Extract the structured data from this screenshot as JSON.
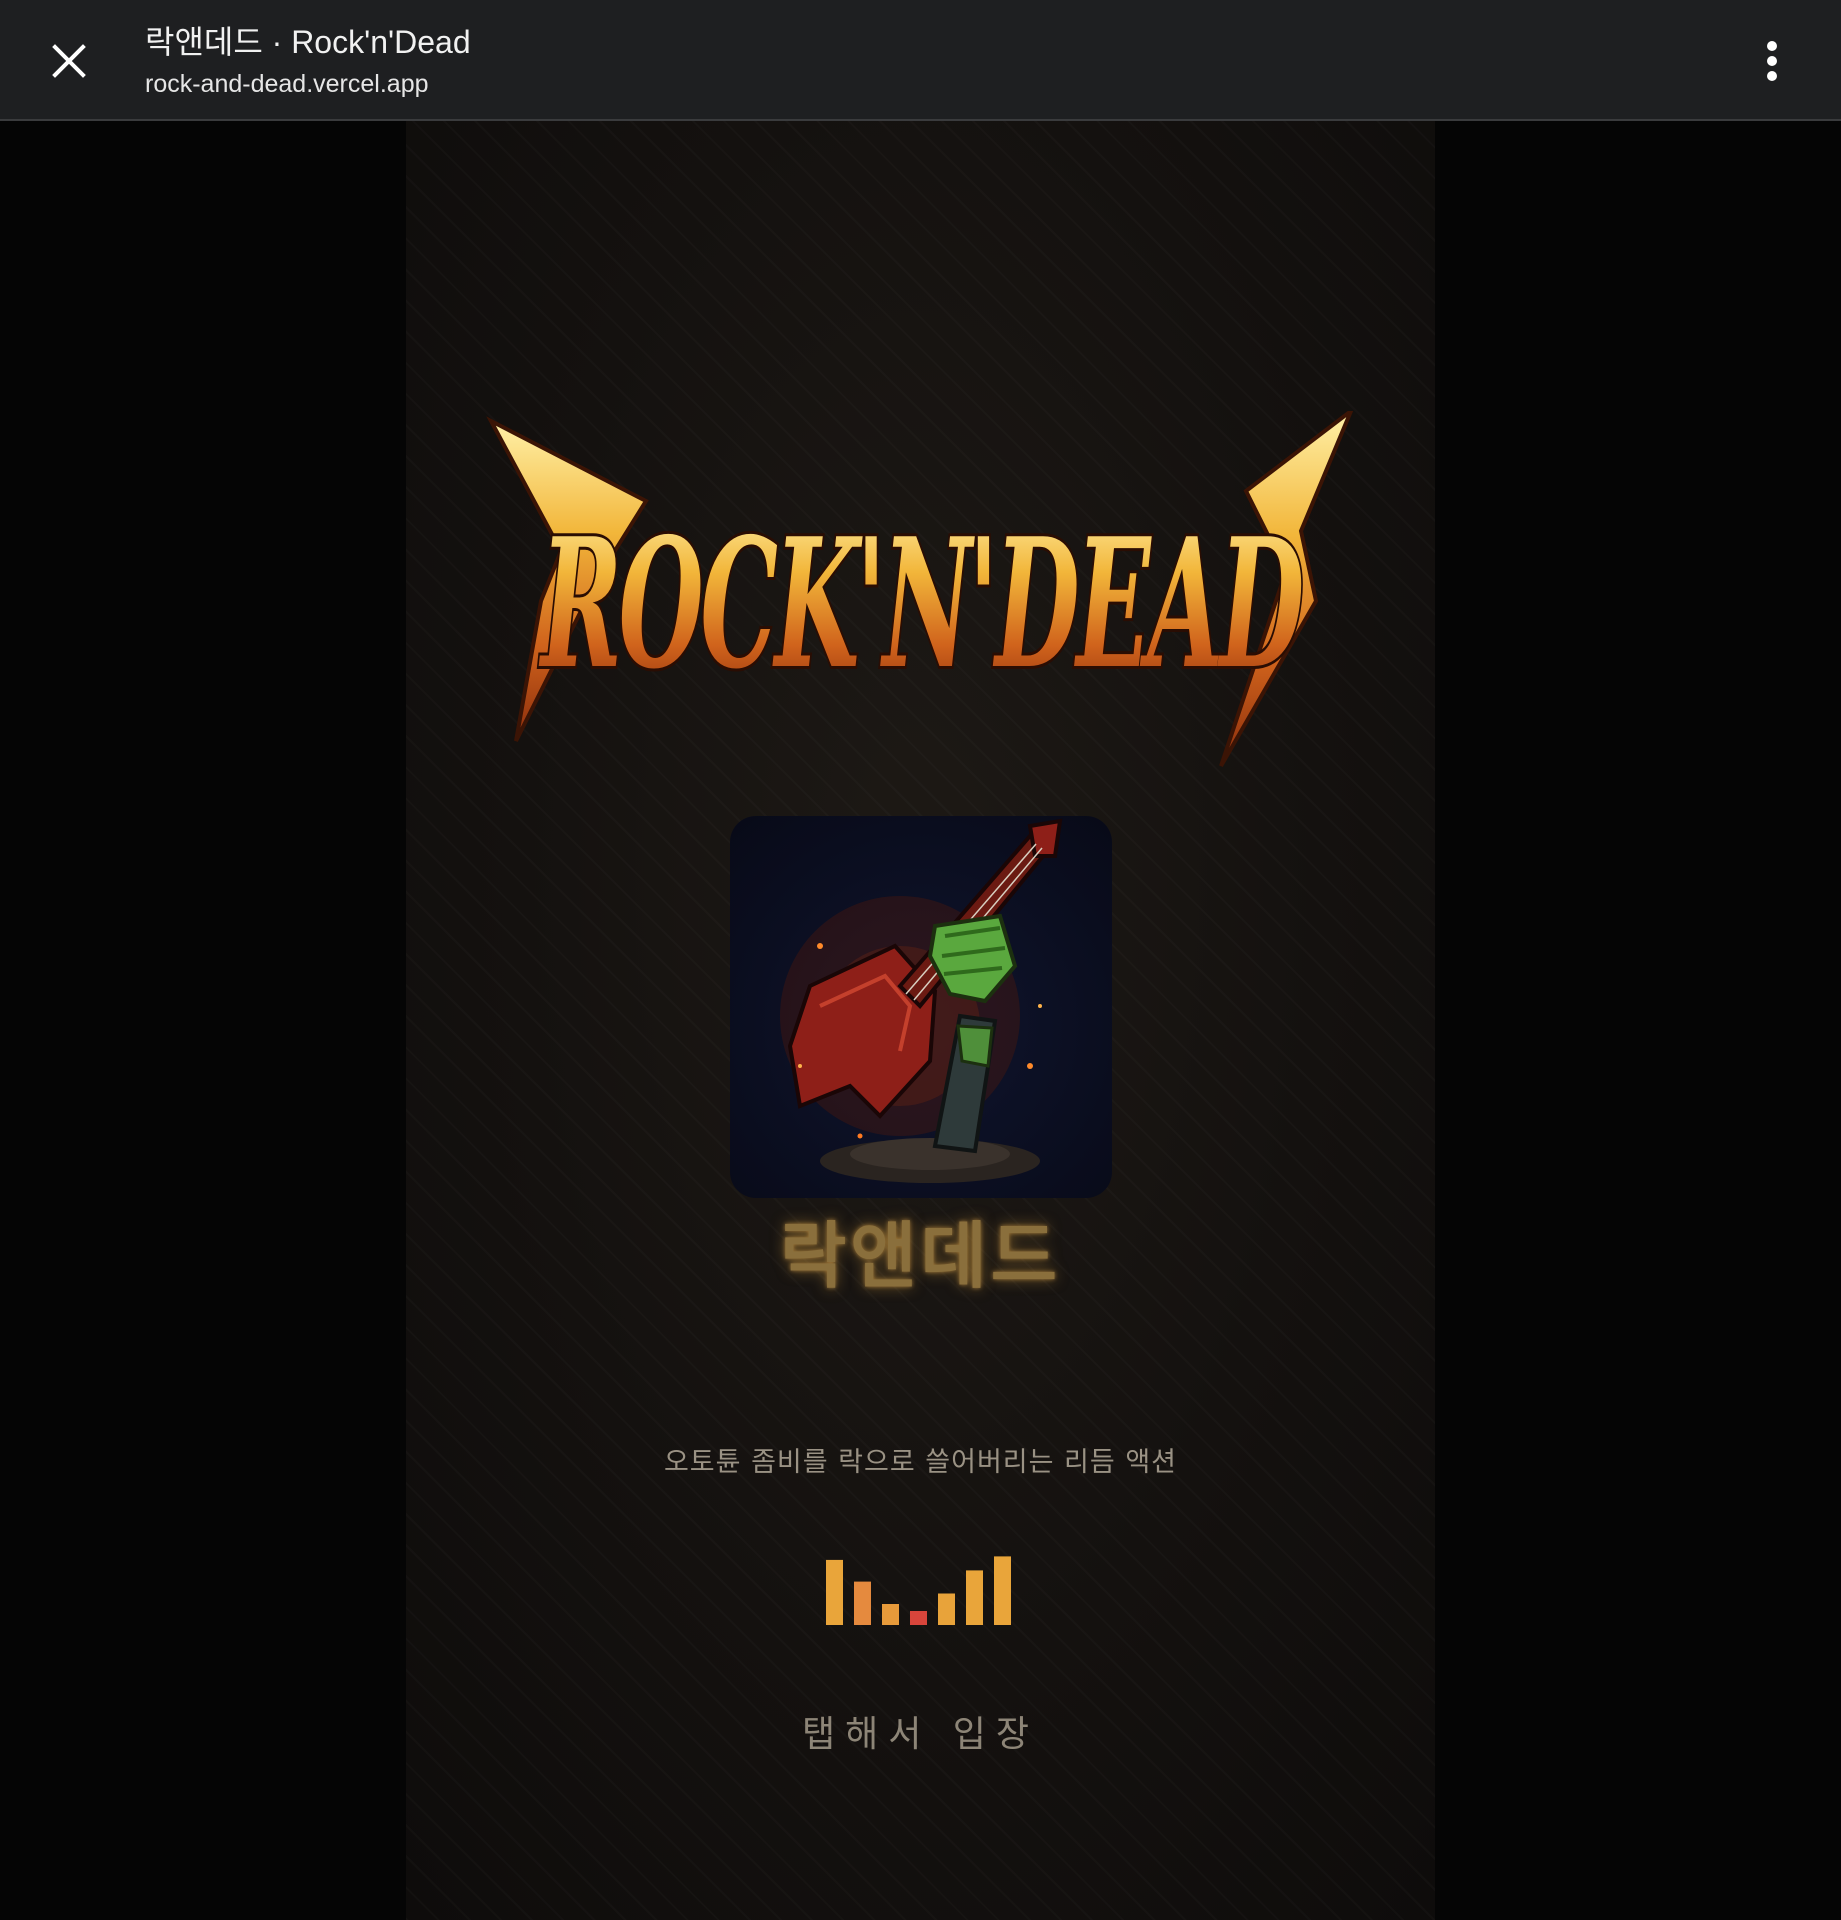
{
  "browser": {
    "title": "락앤데드 · Rock'n'Dead",
    "url": "rock-and-dead.vercel.app"
  },
  "game": {
    "logo_text": "ROCK'N'DEAD",
    "title_ko": "락앤데드",
    "tagline": "오토튠 좀비를 락으로 쓸어버리는 리듬 액션",
    "enter_label": "탭해서 입장",
    "equalizer_levels": [
      0.93,
      0.62,
      0.3,
      0.2,
      0.45,
      0.78,
      0.98
    ],
    "equalizer_colors": [
      "#e9a53a",
      "#e58a3e",
      "#e79a3a",
      "#d8453b",
      "#e8a33a",
      "#e9a53a",
      "#e9a53a"
    ],
    "art_icon": "zombie-hand-guitar-icon"
  },
  "colors": {
    "topbar": "#1e1f21",
    "background": "#050505",
    "accent_gold": "#e9a53a",
    "accent_red": "#d8453b"
  }
}
